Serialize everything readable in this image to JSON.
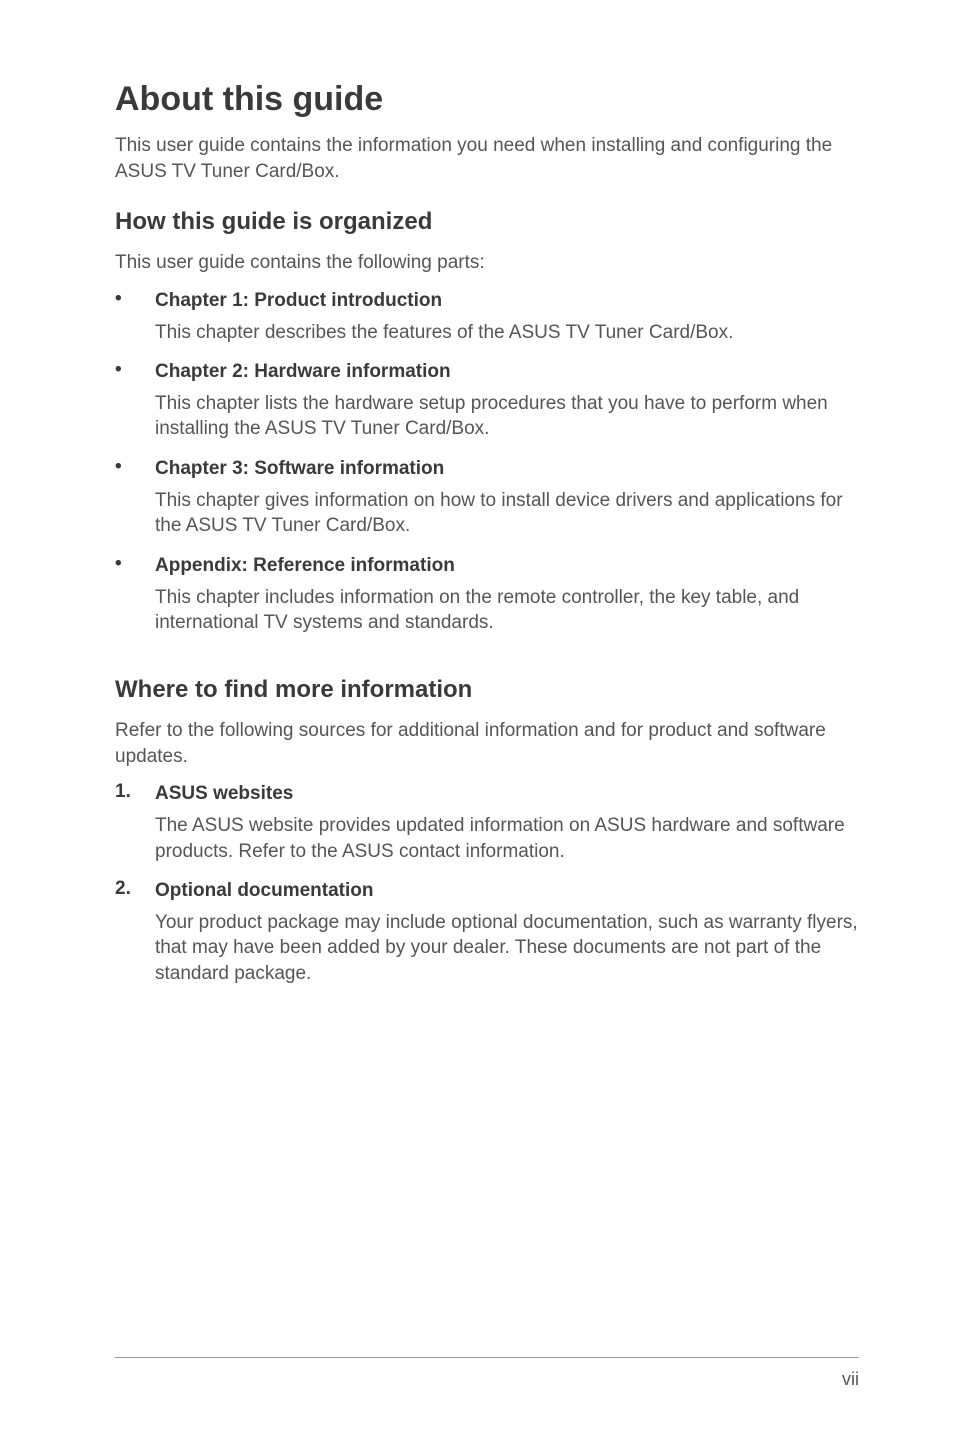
{
  "title": "About this guide",
  "intro": "This user guide contains the information you need when installing and configuring the ASUS TV Tuner Card/Box.",
  "organized": {
    "heading": "How this guide is organized",
    "lead": "This user guide contains the following parts:",
    "items": [
      {
        "title": "Chapter 1: Product introduction",
        "body": "This chapter describes the features of the ASUS TV Tuner Card/Box."
      },
      {
        "title": "Chapter 2: Hardware information",
        "body": "This chapter lists the hardware setup procedures that you have to perform when installing the ASUS TV Tuner Card/Box."
      },
      {
        "title": "Chapter 3: Software information",
        "body": "This chapter gives information on how to install device drivers and applications for the ASUS TV Tuner Card/Box."
      },
      {
        "title": "Appendix: Reference information",
        "body": "This chapter  includes information on the remote controller, the key table, and international TV systems and standards."
      }
    ]
  },
  "moreinfo": {
    "heading": "Where to find more information",
    "lead": "Refer to the following sources for additional information and for product and software updates.",
    "items": [
      {
        "num": "1.",
        "title": "ASUS websites",
        "body": "The ASUS website provides updated information on ASUS hardware and software products. Refer to the ASUS contact information."
      },
      {
        "num": "2.",
        "title": "Optional documentation",
        "body": "Your product package may include optional documentation, such as warranty flyers, that may have been added by your dealer. These documents are not part of the standard package."
      }
    ]
  },
  "pageNumber": "vii",
  "bulletChar": "•"
}
